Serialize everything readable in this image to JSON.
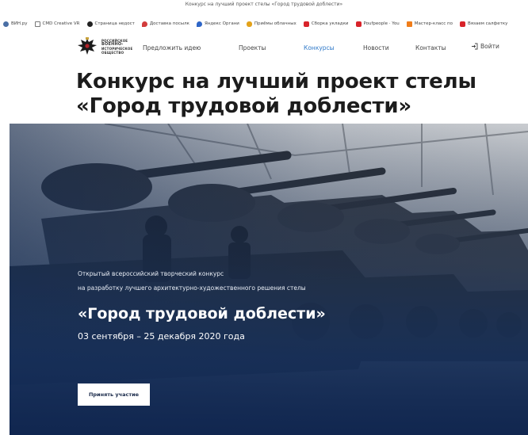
{
  "browser": {
    "window_left": "",
    "tab_title": "Конкурс на лучший проект стелы «Город трудовой доблести»",
    "bookmarks": [
      {
        "label": "ВИН.ру",
        "color": "#4a6fa5",
        "icon": "globe-icon"
      },
      {
        "label": "CMD Creative VR",
        "color": "#777777",
        "icon": "page-icon"
      },
      {
        "label": "Страница недост",
        "color": "#222222",
        "icon": "moon-icon"
      },
      {
        "label": "Доставка посылк",
        "color": "#d23c3c",
        "icon": "pin-icon"
      },
      {
        "label": "Яндекс Органи",
        "color": "#2f66c7",
        "icon": "map-pin-icon"
      },
      {
        "label": "Приёмы облачных",
        "color": "#e3a21a",
        "icon": "cloud-icon"
      },
      {
        "label": "Сборка укладки",
        "color": "#d8232a",
        "icon": "youtube-icon"
      },
      {
        "label": "Poufpeople · You",
        "color": "#d8232a",
        "icon": "youtube-icon"
      },
      {
        "label": "Мастер-класс по",
        "color": "#f07d1a",
        "icon": "bookmark-icon"
      },
      {
        "label": "Вязаем салфетку",
        "color": "#d8232a",
        "icon": "youtube-icon"
      }
    ]
  },
  "header": {
    "logo_lines": [
      "РОССИЙСКОЕ",
      "ВОЕННО-",
      "ИСТОРИЧЕСКОЕ",
      "ОБЩЕСТВО"
    ],
    "nav": [
      {
        "label": "Предложить идею",
        "active": false
      },
      {
        "label": "Проекты",
        "active": false
      },
      {
        "label": "Конкурсы",
        "active": true
      },
      {
        "label": "Новости",
        "active": false
      },
      {
        "label": "Контакты",
        "active": false
      }
    ],
    "login_label": "Войти",
    "accent": "#2e78c8"
  },
  "page": {
    "title_line1": "Конкурс на лучший проект стелы",
    "title_line2": "«Город трудовой доблести»"
  },
  "hero": {
    "subtitle_line1": "Открытый всероссийский творческий конкурс",
    "subtitle_line2": "на разработку лучшего архитектурно-художественного решения стелы",
    "title": "«Город трудовой доблести»",
    "dates": "03 сентября – 25 декабря 2020 года",
    "cta_label": "Принять участие",
    "overlay_color": "#1e3a68"
  }
}
